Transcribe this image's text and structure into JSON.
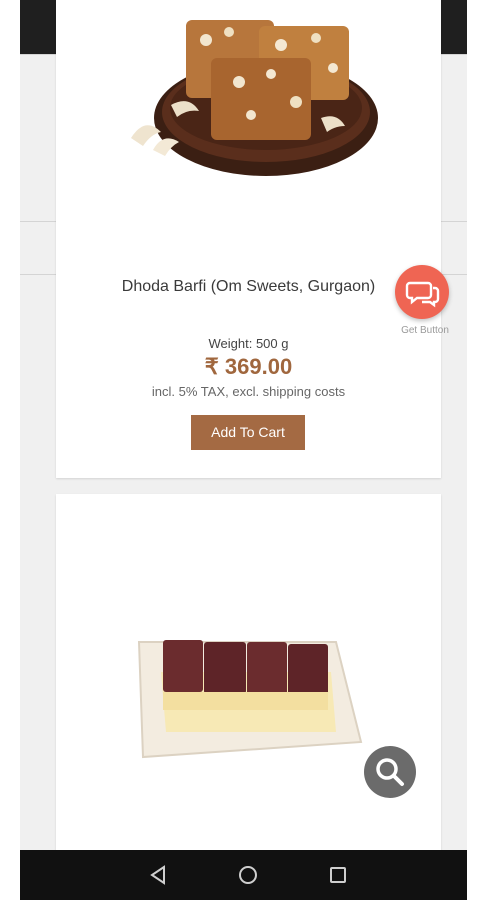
{
  "product": {
    "title": "Dhoda Barfi (Om Sweets, Gurgaon)",
    "weight": "Weight: 500 g",
    "price": "₹ 369.00",
    "tax_note": "incl. 5% TAX, excl. shipping costs",
    "cart_label": "Add To Cart"
  },
  "chat_fab": {
    "label": "Get Button",
    "icon": "chat-bubbles-icon"
  },
  "search_fab": {
    "icon": "search-icon"
  },
  "navbar": {
    "items": [
      "back-icon",
      "home-icon",
      "recents-icon"
    ]
  },
  "colors": {
    "price": "#a0673e",
    "cart_button": "#a46a43",
    "chat_fab": "#ef6553",
    "search_fab": "#6b6b6b"
  }
}
